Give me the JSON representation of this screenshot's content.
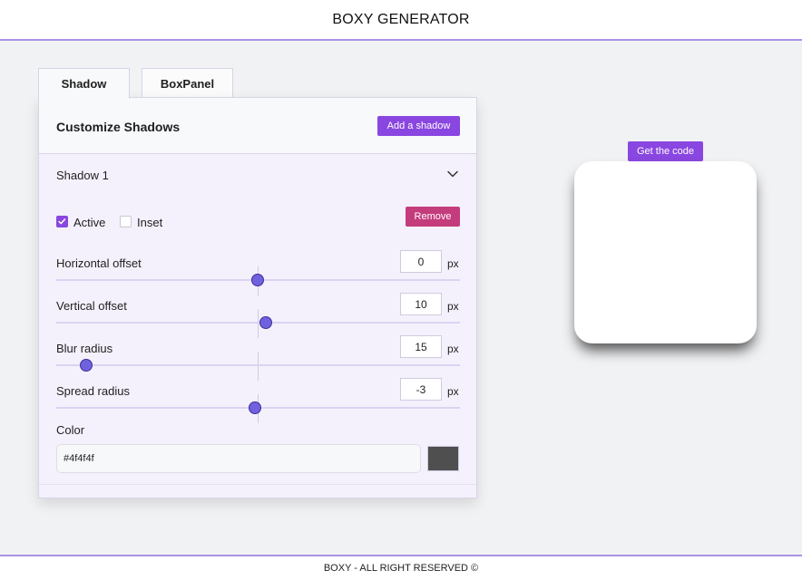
{
  "header": {
    "title": "BOXY GENERATOR"
  },
  "tabs": [
    {
      "label": "Shadow",
      "active": true
    },
    {
      "label": "BoxPanel",
      "active": false
    }
  ],
  "panel": {
    "title": "Customize Shadows",
    "add_label": "Add a shadow",
    "shadow": {
      "title": "Shadow 1",
      "expand_icon": "chevron-down-icon",
      "active_label": "Active",
      "active_checked": true,
      "inset_label": "Inset",
      "inset_checked": false,
      "remove_label": "Remove",
      "fields": [
        {
          "label": "Horizontal offset",
          "value": "0",
          "unit": "px"
        },
        {
          "label": "Vertical offset",
          "value": "10",
          "unit": "px"
        },
        {
          "label": "Blur radius",
          "value": "15",
          "unit": "px"
        },
        {
          "label": "Spread radius",
          "value": "-3",
          "unit": "px"
        }
      ],
      "color_label": "Color",
      "color_value": "#4f4f4f"
    }
  },
  "preview": {
    "code_label": "Get the code"
  },
  "footer": {
    "text": "BOXY - ALL RIGHT RESERVED ©"
  },
  "colors": {
    "accent": "#8a46e0",
    "remove": "#c43c7c",
    "slider_thumb": "#7062de",
    "rule": "#a993e6"
  }
}
